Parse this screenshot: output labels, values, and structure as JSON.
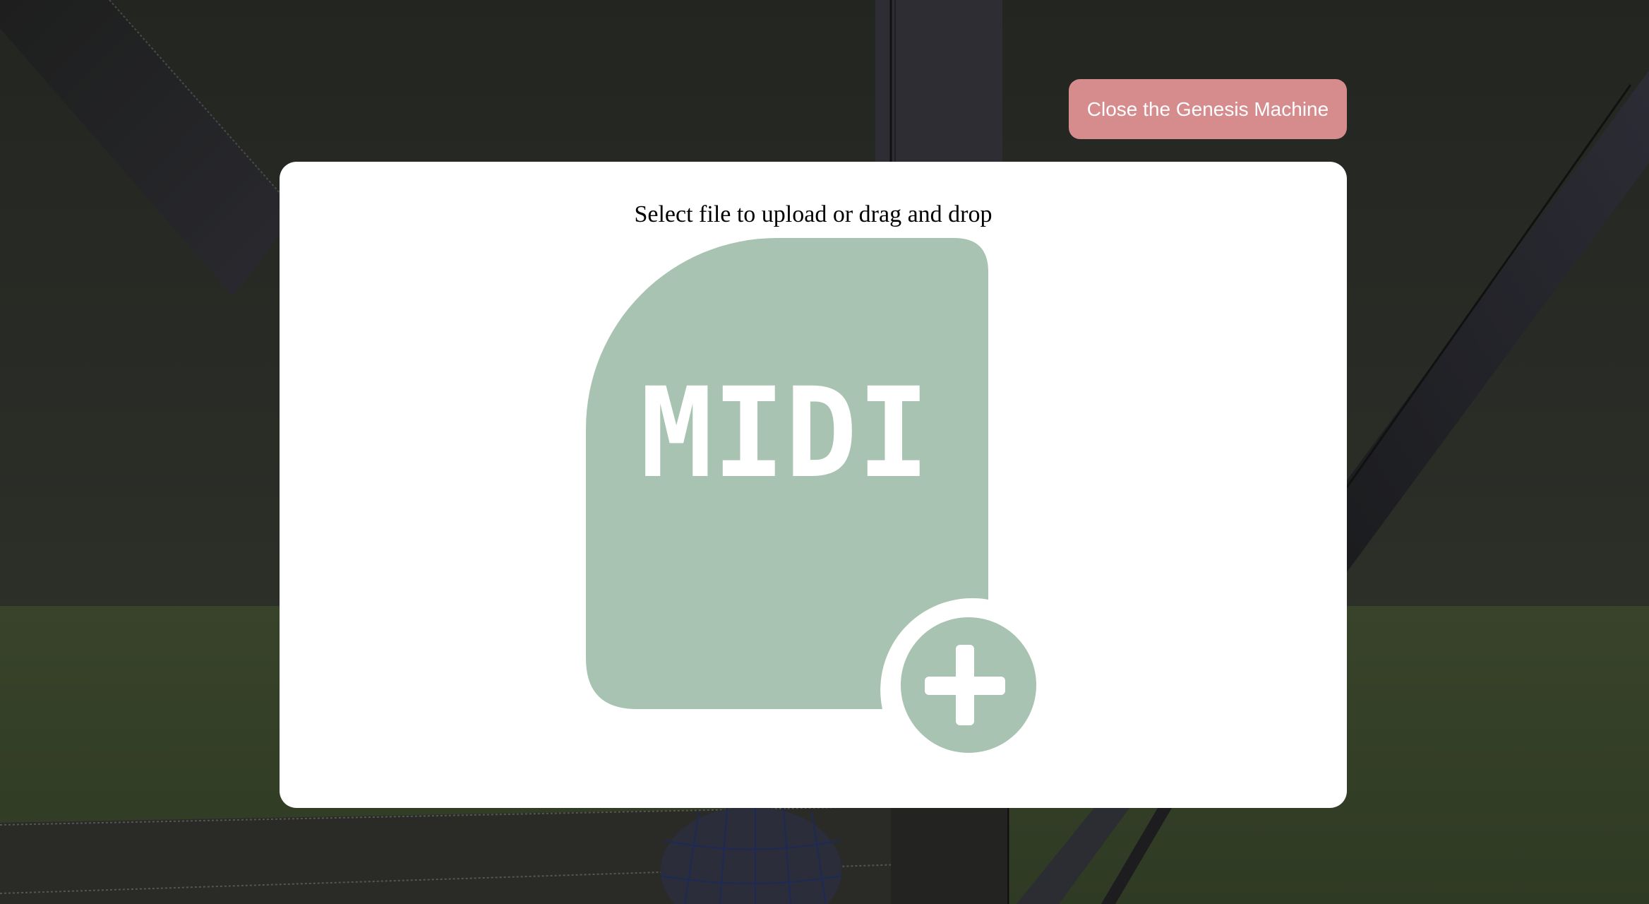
{
  "close_button": {
    "label": "Close the Genesis Machine"
  },
  "upload": {
    "prompt": "Select file to upload or drag and drop",
    "icon_label": "MIDI",
    "icon": "midi-file-add-icon"
  },
  "colors": {
    "close_button_bg": "#d68b8d",
    "icon_green": "#a8c3b1",
    "modal_bg": "#ffffff"
  }
}
